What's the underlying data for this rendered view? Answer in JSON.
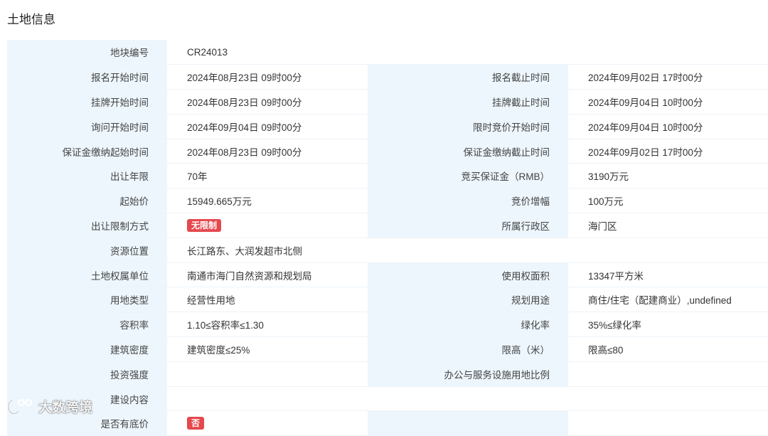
{
  "section": {
    "title": "土地信息"
  },
  "rows": [
    {
      "l1": "地块编号",
      "v1": "CR24013"
    },
    {
      "l1": "报名开始时间",
      "v1": "2024年08月23日 09时00分",
      "l2": "报名截止时间",
      "v2": "2024年09月02日 17时00分"
    },
    {
      "l1": "挂牌开始时间",
      "v1": "2024年08月23日 09时00分",
      "l2": "挂牌截止时间",
      "v2": "2024年09月04日 10时00分"
    },
    {
      "l1": "询问开始时间",
      "v1": "2024年09月04日 09时00分",
      "l2": "限时竞价开始时间",
      "v2": "2024年09月04日 10时00分"
    },
    {
      "l1": "保证金缴纳起始时间",
      "v1": "2024年08月23日 09时00分",
      "l2": "保证金缴纳截止时间",
      "v2": "2024年09月02日 17时00分"
    },
    {
      "l1": "出让年限",
      "v1": "70年",
      "l2": "竞买保证金（RMB）",
      "v2": "3190万元"
    },
    {
      "l1": "起始价",
      "v1": "15949.665万元",
      "l2": "竞价增幅",
      "v2": "100万元"
    },
    {
      "l1": "出让限制方式",
      "v1": "无限制",
      "l2": "所属行政区",
      "v2": "海门区"
    },
    {
      "l1": "资源位置",
      "v1": "长江路东、大润发超市北侧"
    },
    {
      "l1": "土地权属单位",
      "v1": "南通市海门自然资源和规划局",
      "l2": "使用权面积",
      "v2": "13347平方米"
    },
    {
      "l1": "用地类型",
      "v1": "经营性用地",
      "l2": "规划用途",
      "v2": "商住/住宅（配建商业）,undefined"
    },
    {
      "l1": "容积率",
      "v1": "1.10≤容积率≤1.30",
      "l2": "绿化率",
      "v2": "35%≤绿化率"
    },
    {
      "l1": "建筑密度",
      "v1": "建筑密度≤25%",
      "l2": "限高（米）",
      "v2": "限高≤80"
    },
    {
      "l1": "投资强度",
      "v1": "",
      "l2": "办公与服务设施用地比例",
      "v2": ""
    },
    {
      "l1": "建设内容",
      "v1": ""
    },
    {
      "l1": "是否有底价",
      "v1": "否"
    }
  ],
  "watermark": {
    "text": "大数跨境"
  },
  "colors": {
    "label_bg": "#edf6fd",
    "badge_bg": "#e5484d",
    "border": "#eef4f9"
  }
}
